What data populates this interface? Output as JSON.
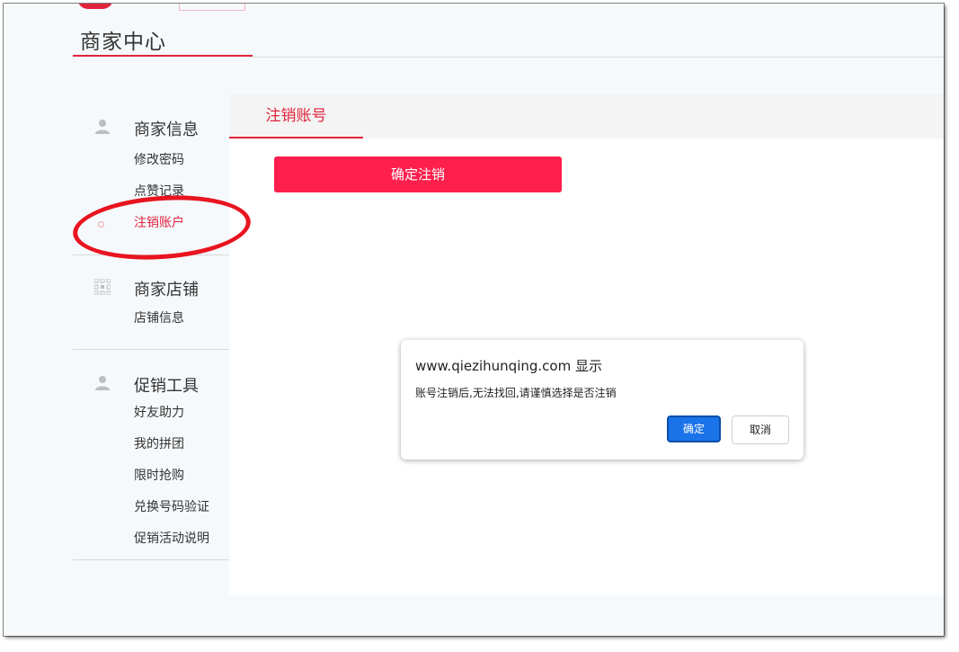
{
  "header": {
    "title": "商家中心"
  },
  "sidebar": {
    "groups": [
      {
        "title": "商家信息",
        "icon": "user-icon",
        "items": [
          {
            "label": "修改密码"
          },
          {
            "label": "点赞记录"
          },
          {
            "label": "注销账户",
            "active": true
          }
        ]
      },
      {
        "title": "商家店铺",
        "icon": "grid-icon",
        "items": [
          {
            "label": "店铺信息"
          }
        ]
      },
      {
        "title": "促销工具",
        "icon": "user-icon",
        "items": [
          {
            "label": "好友助力"
          },
          {
            "label": "我的拼团"
          },
          {
            "label": "限时抢购"
          },
          {
            "label": "兑换号码验证"
          },
          {
            "label": "促销活动说明"
          }
        ]
      }
    ]
  },
  "main": {
    "tab": "注销账号",
    "confirm_button": "确定注销"
  },
  "dialog": {
    "title": "www.qiezihunqing.com 显示",
    "message": "账号注销后,无法找回,请谨慎选择是否注销",
    "ok": "确定",
    "cancel": "取消"
  },
  "colors": {
    "accent": "#e0243c",
    "button": "#ff1f4c",
    "dialog_ok": "#1a73e8"
  }
}
